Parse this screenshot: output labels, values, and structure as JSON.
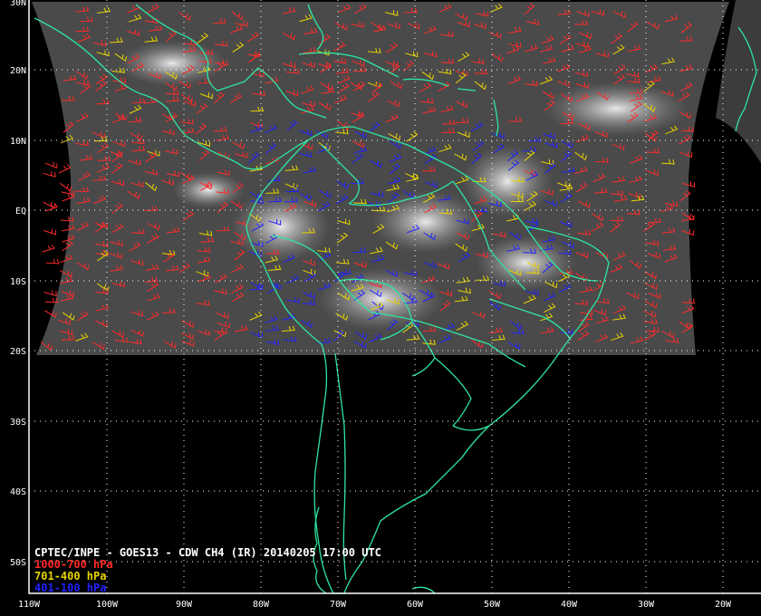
{
  "map": {
    "caption": {
      "title": "CPTEC/INPE - GOES13 - CDW CH4 (IR) 20140205 17:00 UTC",
      "levels": [
        {
          "label": "1000-700 hPa",
          "color": "#ff2a2a"
        },
        {
          "label": "701-400 hPa",
          "color": "#e8d400"
        },
        {
          "label": "401-100 hPa",
          "color": "#2222ff"
        }
      ]
    },
    "lat_labels": [
      "30N",
      "20N",
      "10N",
      "EQ",
      "10S",
      "20S",
      "30S",
      "40S",
      "50S"
    ],
    "lon_labels": [
      "110W",
      "100W",
      "90W",
      "80W",
      "70W",
      "60W",
      "50W",
      "40W",
      "30W",
      "20W"
    ],
    "colors": {
      "background": "#000000",
      "coastline": "#2ee6a0",
      "grid": "#ffffff",
      "frame": "#ffffff"
    }
  }
}
